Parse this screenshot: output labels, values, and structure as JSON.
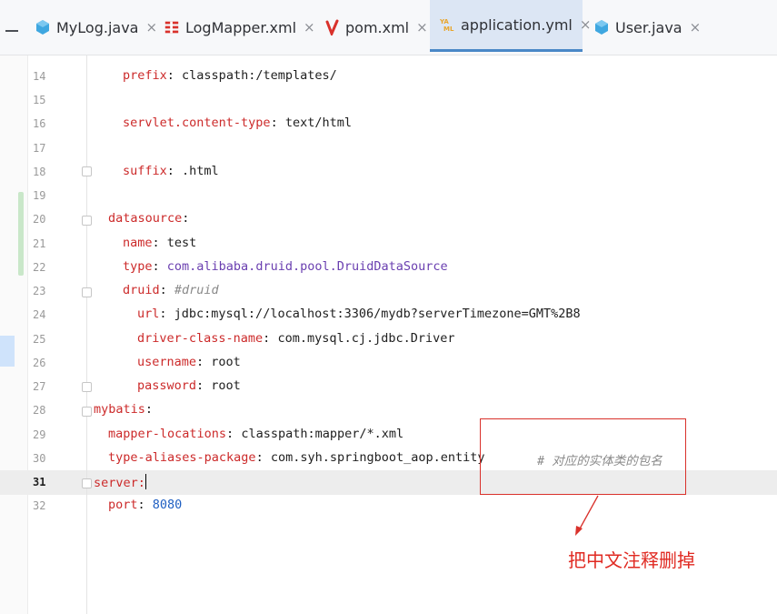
{
  "tabs": [
    {
      "label": "MyLog.java",
      "icon": "java-class-icon",
      "active": false
    },
    {
      "label": "LogMapper.xml",
      "icon": "mapper-xml-icon",
      "active": false
    },
    {
      "label": "pom.xml",
      "icon": "maven-icon",
      "active": false
    },
    {
      "label": "application.yml",
      "icon": "yaml-icon",
      "active": true
    },
    {
      "label": "User.java",
      "icon": "java-class-icon",
      "active": false
    }
  ],
  "tab_close_glyph": "×",
  "colors": {
    "key": "#cc2a2a",
    "number": "#1f5fc2",
    "comment": "#8a8a8a",
    "annotation": "#e02a22",
    "active_tab": "#dce6f4"
  },
  "editor": {
    "current_line": 31,
    "lines": [
      {
        "n": "14",
        "key": "prefix",
        "val": "classpath:/templates/"
      },
      {
        "n": "15"
      },
      {
        "n": "16",
        "key": "servlet.content-type",
        "val": "text/html"
      },
      {
        "n": "17"
      },
      {
        "n": "18",
        "key": "suffix",
        "val": ".html"
      },
      {
        "n": "19"
      },
      {
        "n": "20",
        "key": "datasource"
      },
      {
        "n": "21",
        "key": "name",
        "val": "test"
      },
      {
        "n": "22",
        "key": "type",
        "val": "com.alibaba.druid.pool.DruidDataSource"
      },
      {
        "n": "23",
        "key": "druid",
        "comment": "#druid"
      },
      {
        "n": "24",
        "key": "url",
        "val": "jdbc:mysql://localhost:3306/mydb?serverTimezone=GMT%2B8"
      },
      {
        "n": "25",
        "key": "driver-class-name",
        "val": "com.mysql.cj.jdbc.Driver"
      },
      {
        "n": "26",
        "key": "username",
        "val": "root"
      },
      {
        "n": "27",
        "key": "password",
        "val": "root"
      },
      {
        "n": "28",
        "key": "mybatis"
      },
      {
        "n": "29",
        "key": "mapper-locations",
        "val": "classpath:mapper/*.xml"
      },
      {
        "n": "30",
        "key": "type-aliases-package",
        "val": "com.syh.springboot_aop.entity",
        "comment": "# 对应的实体类的包名"
      },
      {
        "n": "31",
        "key": "server"
      },
      {
        "n": "32",
        "key": "port",
        "val": "8080"
      }
    ]
  },
  "annotation": {
    "text": "把中文注释删掉"
  }
}
